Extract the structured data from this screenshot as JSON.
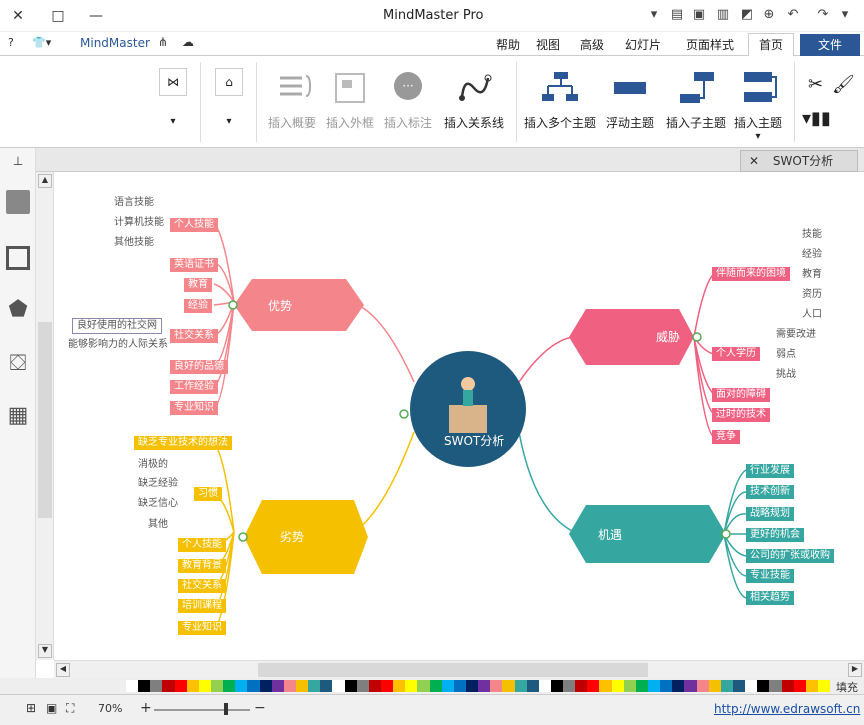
{
  "window": {
    "title": "MindMaster Pro",
    "minimize": "—",
    "maximize": "□",
    "close": "✕",
    "brand": "MindMaster"
  },
  "menu": {
    "tabs": [
      "文件",
      "首页",
      "页面样式",
      "幻灯片",
      "高级",
      "视图",
      "帮助"
    ],
    "active": "首页"
  },
  "ribbon": {
    "buttons": [
      "插入主题",
      "插入子主题",
      "浮动主题",
      "插入多个主题",
      "插入关系线",
      "插入标注",
      "插入外框",
      "插入概要"
    ]
  },
  "doc_tab": {
    "title": "SWOT分析",
    "close": "✕"
  },
  "center": {
    "label": "SWOT分析",
    "color": "#1e5a7e"
  },
  "branches": {
    "strength": {
      "label": "优势",
      "color": "#f4858a",
      "items": [
        "个人技能",
        "英语证书",
        "教育",
        "经验",
        "社交关系",
        "良好的品德",
        "工作经验",
        "专业知识"
      ],
      "sub_skills": [
        "语言技能",
        "计算机技能",
        "其他技能"
      ],
      "sub_social": [
        "良好使用的社交网",
        "能够影响力的人际关系"
      ]
    },
    "threat": {
      "label": "威胁",
      "color": "#f06080",
      "items": [
        "伴随而来的困境",
        "个人学历",
        "面对的障碍",
        "过时的技术",
        "竞争"
      ],
      "sub1": [
        "技能",
        "经验",
        "教育",
        "资历",
        "人口"
      ],
      "sub2": [
        "需要改进",
        "弱点",
        "挑战"
      ]
    },
    "weakness": {
      "label": "劣势",
      "color": "#f5c000",
      "items": [
        "缺乏专业技术的想法",
        "习惯",
        "个人技能",
        "教育背景",
        "社交关系",
        "培训课程",
        "专业知识"
      ],
      "sub_habit": [
        "消极的",
        "缺乏经验",
        "缺乏信心",
        "其他"
      ]
    },
    "opportunity": {
      "label": "机遇",
      "color": "#36a6a0",
      "items": [
        "行业发展",
        "技术创新",
        "战略规划",
        "更好的机会",
        "公司的扩张或收购",
        "专业技能",
        "相关趋势"
      ]
    }
  },
  "status": {
    "url": "http://www.edrawsoft.cn",
    "zoom": "70%",
    "fill_label": "填充"
  },
  "palette": [
    "#ffffff",
    "#000000",
    "#7f7f7f",
    "#c00000",
    "#ff0000",
    "#ffc000",
    "#ffff00",
    "#92d050",
    "#00b050",
    "#00b0f0",
    "#0070c0",
    "#002060",
    "#7030a0",
    "#f4858a",
    "#f5c000",
    "#36a6a0",
    "#1e5a7e"
  ]
}
